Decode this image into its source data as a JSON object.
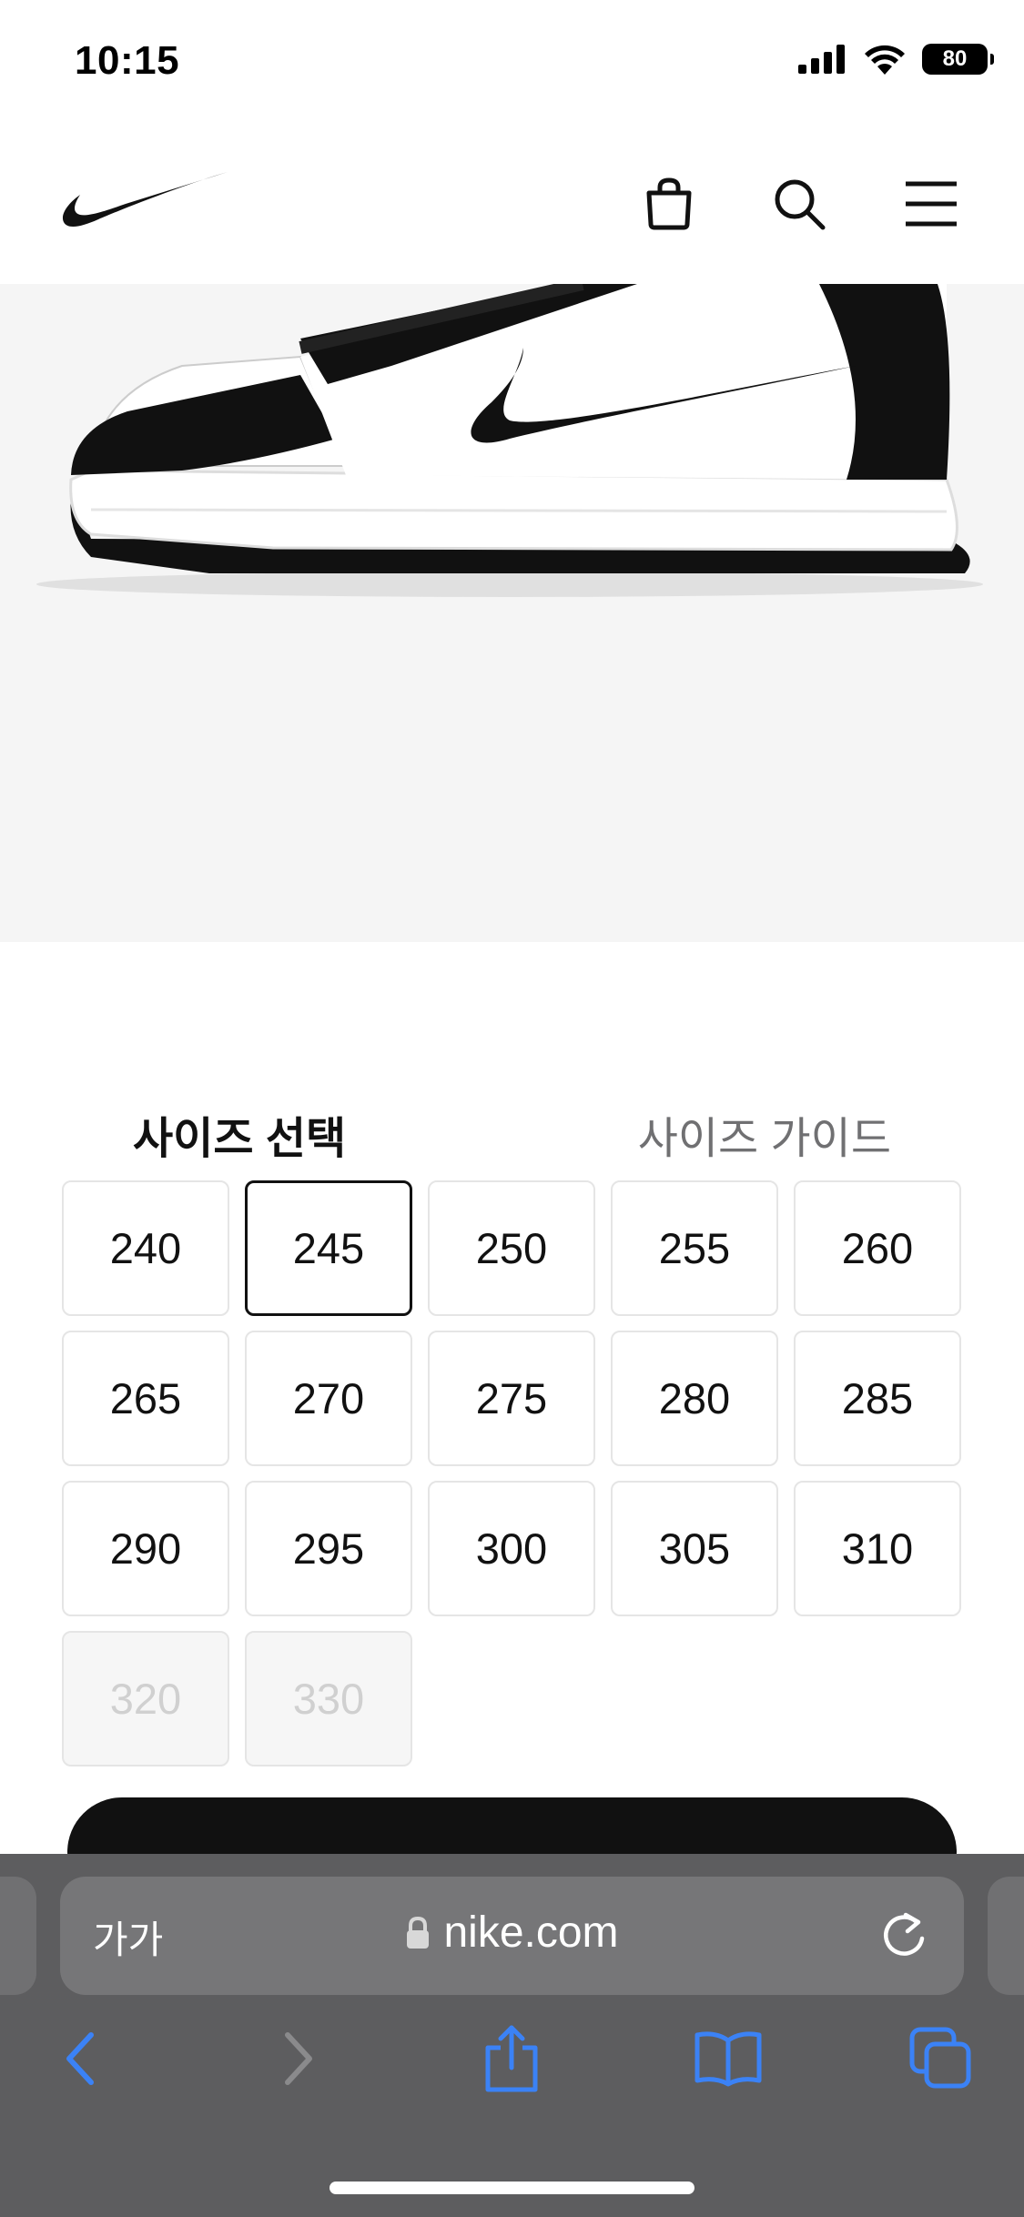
{
  "status_bar": {
    "time": "10:15",
    "battery": "80",
    "icons": [
      "cellular-signal-icon",
      "wifi-icon",
      "battery-icon"
    ]
  },
  "header": {
    "logo": "nike-swoosh-logo",
    "icons": [
      "bag-icon",
      "search-icon",
      "menu-icon"
    ]
  },
  "product": {
    "image": "panda-dunk-low-sneaker",
    "background": "#f5f5f5"
  },
  "size_section": {
    "title": "사이즈 선택",
    "guide_label": "사이즈 가이드",
    "sizes": [
      {
        "label": "240",
        "state": "available"
      },
      {
        "label": "245",
        "state": "selected"
      },
      {
        "label": "250",
        "state": "available"
      },
      {
        "label": "255",
        "state": "available"
      },
      {
        "label": "260",
        "state": "available"
      },
      {
        "label": "265",
        "state": "available"
      },
      {
        "label": "270",
        "state": "available"
      },
      {
        "label": "275",
        "state": "available"
      },
      {
        "label": "280",
        "state": "available"
      },
      {
        "label": "285",
        "state": "available"
      },
      {
        "label": "290",
        "state": "available"
      },
      {
        "label": "295",
        "state": "available"
      },
      {
        "label": "300",
        "state": "available"
      },
      {
        "label": "305",
        "state": "available"
      },
      {
        "label": "310",
        "state": "available"
      },
      {
        "label": "320",
        "state": "disabled"
      },
      {
        "label": "330",
        "state": "disabled"
      }
    ]
  },
  "browser": {
    "text_size_label": "가가",
    "url": "nike.com",
    "toolbar": [
      "back-icon",
      "forward-icon",
      "share-icon",
      "bookmarks-icon",
      "tabs-icon"
    ],
    "accent_color": "#3b82f6"
  },
  "colors": {
    "selected_border": "#111111",
    "cta": "#111111",
    "disabled_text": "#d0d0d0"
  }
}
